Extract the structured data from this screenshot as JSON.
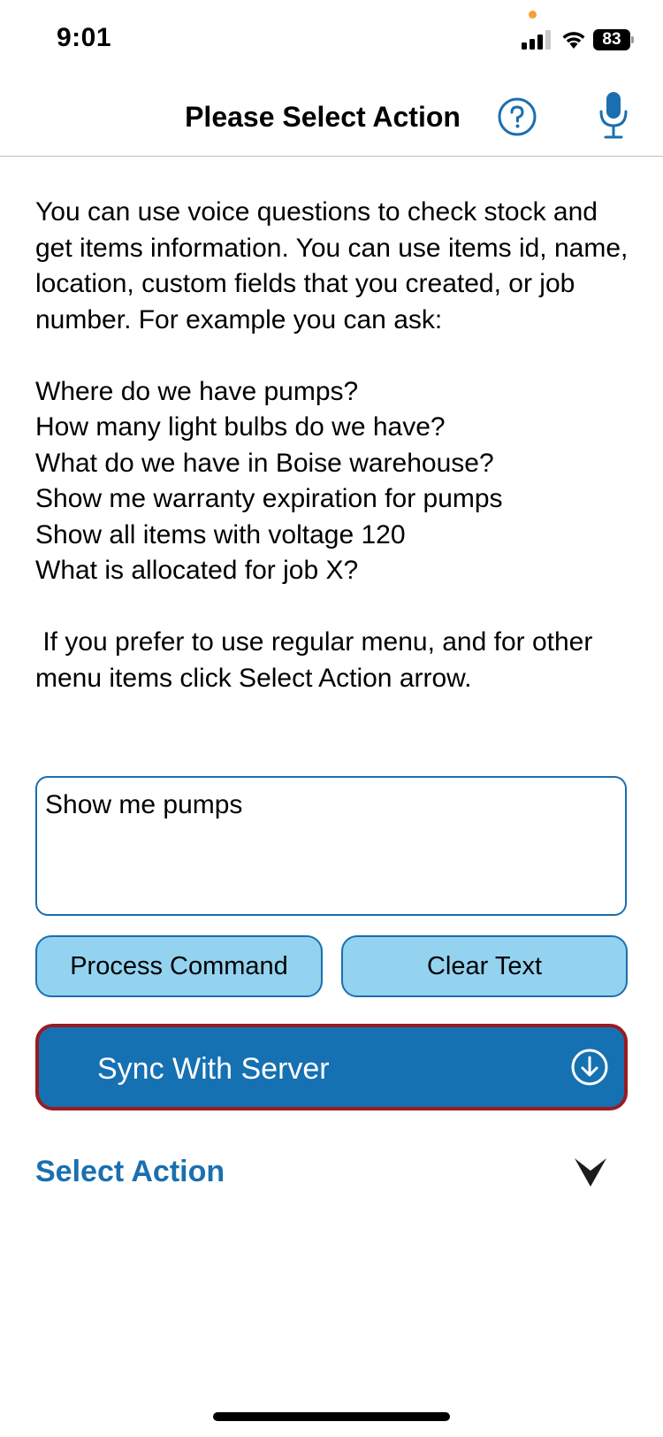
{
  "status_bar": {
    "time": "9:01",
    "battery_level": "83",
    "icons": [
      "signal-icon",
      "wifi-icon",
      "battery-icon"
    ]
  },
  "nav": {
    "title": "Please Select Action",
    "help_icon": "help-circle-icon",
    "mic_icon": "microphone-icon"
  },
  "info": {
    "intro": "You can use voice questions to check stock and get items information. You can use items id, name, location, custom fields that you created, or job number. For example you can ask:",
    "examples": [
      "Where do we have pumps?",
      "How many light bulbs do we have?",
      "What do we have in Boise warehouse?",
      "Show me warranty expiration for pumps",
      "Show all items with voltage 120",
      "What is allocated for job X?"
    ],
    "outro": " If you prefer to use regular menu, and for other menu items click Select Action arrow."
  },
  "command": {
    "value": "Show me pumps"
  },
  "buttons": {
    "process": "Process Command",
    "clear": "Clear Text",
    "sync": "Sync With Server"
  },
  "select_action": {
    "label": "Select Action"
  },
  "colors": {
    "accent": "#1a6fb0",
    "light_button": "#93d3f0",
    "sync_button": "#1571b2",
    "sync_border": "#9a1b22",
    "privacy_dot": "#f5a033"
  }
}
